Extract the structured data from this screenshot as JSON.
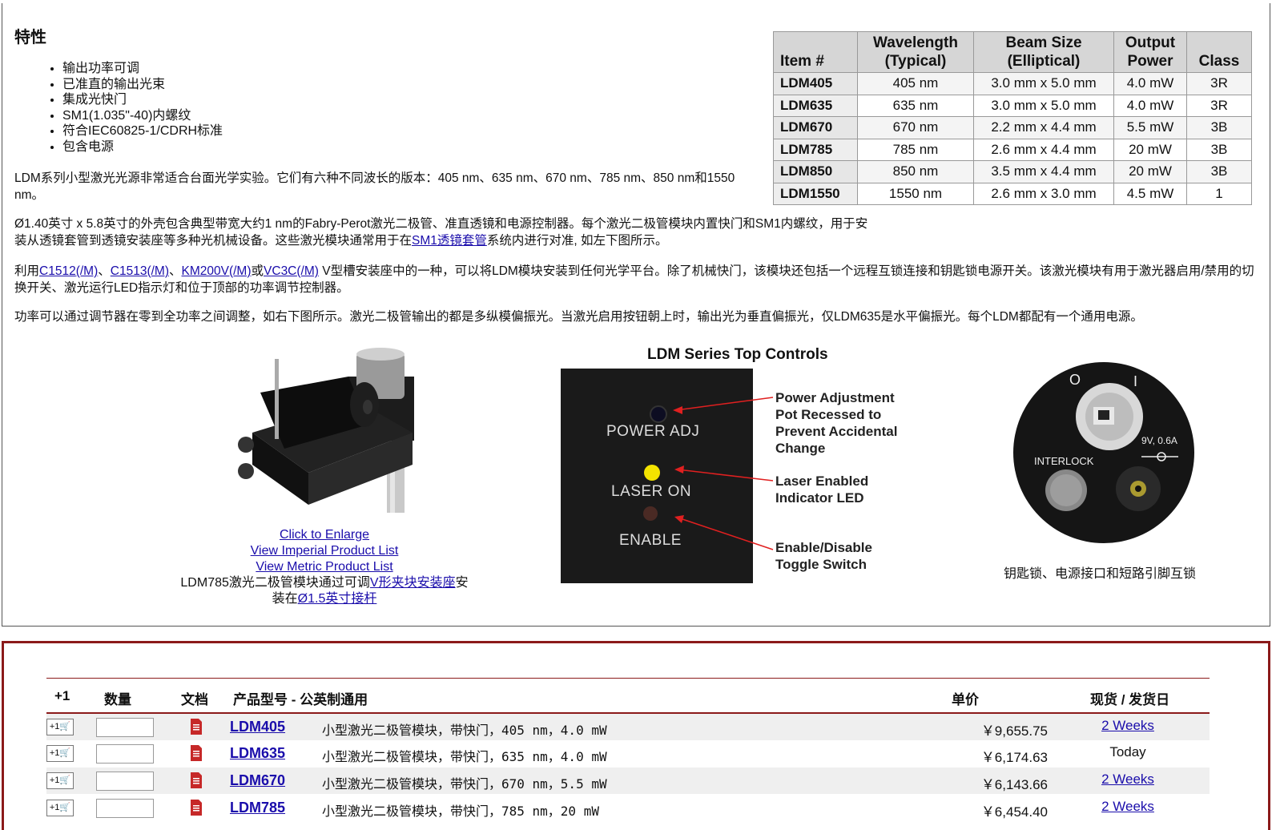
{
  "features": {
    "heading": "特性",
    "items": [
      "输出功率可调",
      "已准直的输出光束",
      "集成光快门",
      "SM1(1.035\"-40)内螺纹",
      "符合IEC60825-1/CDRH标准",
      "包含电源"
    ]
  },
  "paragraphs": {
    "p1": "LDM系列小型激光光源非常适合台面光学实验。它们有六种不同波长的版本：405 nm、635 nm、670 nm、785 nm、850 nm和1550 nm。",
    "p2_a": "Ø1.40英寸 x 5.8英寸的外壳包含典型带宽大约1 nm的Fabry-Perot激光二极管、准直透镜和电源控制器。每个激光二极管模块内置快门和SM1内螺纹，用于安装从透镜套管到透镜安装座等多种光机械设备。这些激光模块通常用于在",
    "p2_link": "SM1透镜套管",
    "p2_b": "系统内进行对准, 如左下图所示。",
    "p3_pre": "利用",
    "p3_l1": "C1512",
    "p3_l1m": "(/M)",
    "p3_sep1": "、",
    "p3_l2": "C1513",
    "p3_l2m": "(/M)",
    "p3_sep2": "、",
    "p3_l3": "KM200V",
    "p3_l3m": "(/M)",
    "p3_or": "或",
    "p3_l4": "VC3C",
    "p3_l4m": "(/M)",
    "p3_post": " V型槽安装座中的一种，可以将LDM模块安装到任何光学平台。除了机械快门，该模块还包括一个远程互锁连接和钥匙锁电源开关。该激光模块有用于激光器启用/禁用的切换开关、激光运行LED指示灯和位于顶部的功率调节控制器。",
    "p4": "功率可以通过调节器在零到全功率之间调整，如右下图所示。激光二极管输出的都是多纵模偏振光。当激光启用按钮朝上时，输出光为垂直偏振光，仅LDM635是水平偏振光。每个LDM都配有一个通用电源。"
  },
  "spec_table": {
    "headers": [
      "Item #",
      "Wavelength (Typical)",
      "Beam Size (Elliptical)",
      "Output Power",
      "Class"
    ],
    "rows": [
      [
        "LDM405",
        "405 nm",
        "3.0 mm x 5.0 mm",
        "4.0 mW",
        "3R"
      ],
      [
        "LDM635",
        "635 nm",
        "3.0 mm x 5.0 mm",
        "4.0 mW",
        "3R"
      ],
      [
        "LDM670",
        "670 nm",
        "2.2 mm x 4.4 mm",
        "5.5 mW",
        "3B"
      ],
      [
        "LDM785",
        "785 nm",
        "2.6 mm x 4.4 mm",
        "20 mW",
        "3B"
      ],
      [
        "LDM850",
        "850 nm",
        "3.5 mm x 4.4 mm",
        "20 mW",
        "3B"
      ],
      [
        "LDM1550",
        "1550 nm",
        "2.6 mm x 3.0 mm",
        "4.5 mW",
        "1"
      ]
    ]
  },
  "figure1": {
    "enlarge": "Click to Enlarge",
    "imperial": "View Imperial Product List",
    "metric": "View Metric Product List",
    "caption_a": "LDM785激光二极管模块通过可调",
    "caption_link1": "V形夹块安装座",
    "caption_b": "安装在",
    "caption_link2": "Ø1.5英寸接杆"
  },
  "figure2": {
    "title": "LDM Series Top Controls",
    "label_power": "POWER ADJ",
    "label_laser": "LASER ON",
    "label_enable": "ENABLE",
    "ann1": "Power Adjustment Pot Recessed to Prevent Accidental Change",
    "ann2": "Laser Enabled Indicator LED",
    "ann3": "Enable/Disable Toggle Switch"
  },
  "figure3": {
    "off": "O",
    "on": "I",
    "interlock": "INTERLOCK",
    "power_rating": "9V, 0.6A",
    "caption": "钥匙锁、电源接口和短路引脚互锁"
  },
  "cart": {
    "headers": {
      "add": "+1",
      "qty": "数量",
      "docs": "文档",
      "part": "产品型号 - 公英制通用",
      "price": "单价",
      "avail": "现货 / 发货日"
    },
    "add_label": "+1🛒",
    "rows": [
      {
        "part": "LDM405",
        "desc": "小型激光二极管模块，带快门，405 nm，4.0 mW",
        "price": "￥9,655.75",
        "avail": "2 Weeks",
        "avail_link": true
      },
      {
        "part": "LDM635",
        "desc": "小型激光二极管模块，带快门，635 nm，4.0 mW",
        "price": "￥6,174.63",
        "avail": "Today",
        "avail_link": false
      },
      {
        "part": "LDM670",
        "desc": "小型激光二极管模块，带快门，670 nm，5.5 mW",
        "price": "￥6,143.66",
        "avail": "2 Weeks",
        "avail_link": true
      },
      {
        "part": "LDM785",
        "desc": "小型激光二极管模块，带快门，785 nm，20 mW",
        "price": "￥6,454.40",
        "avail": "2 Weeks",
        "avail_link": true
      }
    ]
  }
}
